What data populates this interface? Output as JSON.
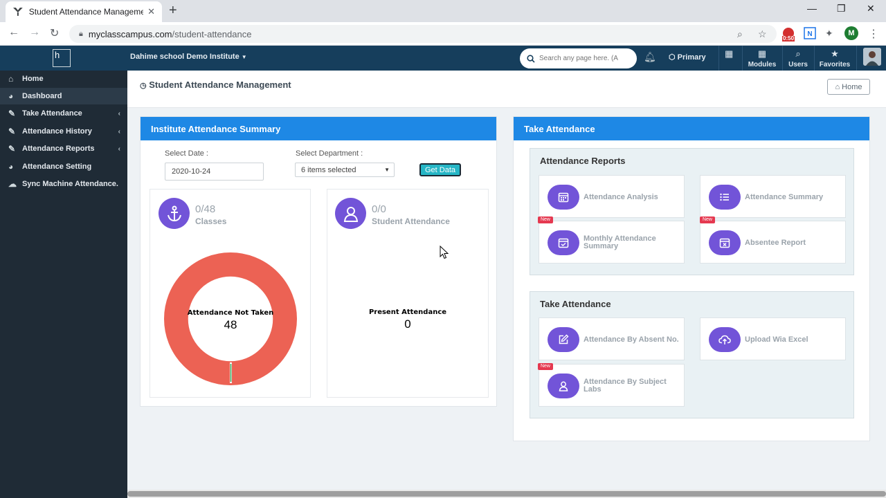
{
  "browser": {
    "tab_title": "Student Attendance Management",
    "url_host": "myclasscampus.com",
    "url_path": "/student-attendance",
    "timer": "0:50",
    "profile_initial": "M"
  },
  "header": {
    "institute": "Dahime school Demo Institute",
    "search_placeholder": "Search any page here. (A",
    "notif_count": "0",
    "primary": "Primary",
    "modules": "Modules",
    "users": "Users",
    "favorites": "Favorites"
  },
  "sidebar": {
    "items": [
      {
        "label": "Home"
      },
      {
        "label": "Dashboard"
      },
      {
        "label": "Take Attendance"
      },
      {
        "label": "Attendance History"
      },
      {
        "label": "Attendance Reports"
      },
      {
        "label": "Attendance Setting"
      },
      {
        "label": "Sync Machine Attendance."
      }
    ]
  },
  "page": {
    "title": "Student Attendance Management",
    "home_button": "Home"
  },
  "summary": {
    "title": "Institute Attendance Summary",
    "date_label": "Select Date :",
    "date_value": "2020-10-24",
    "dept_label": "Select Department :",
    "dept_value": "6 items selected",
    "get_data": "Get Data",
    "classes_count": "0/48",
    "classes_label": "Classes",
    "students_count": "0/0",
    "students_label": "Student Attendance",
    "donut_label": "Attendance Not Taken",
    "donut_value": "48",
    "present_label": "Present Attendance",
    "present_value": "0"
  },
  "take": {
    "title": "Take Attendance",
    "reports_title": "Attendance Reports",
    "reports": [
      {
        "label": "Attendance Analysis"
      },
      {
        "label": "Attendance Summary"
      },
      {
        "label": "Monthly Attendance Summary",
        "badge": "New"
      },
      {
        "label": "Absentee Report",
        "badge": "New"
      }
    ],
    "take_title": "Take Attendance",
    "actions": [
      {
        "label": "Attendance By Absent No."
      },
      {
        "label": "Upload Wia Excel"
      },
      {
        "label": "Attendance By Subject Labs",
        "badge": "New"
      }
    ]
  },
  "colors": {
    "accent_blue": "#1e88e5",
    "nav_dark": "#163e5c",
    "sidebar": "#1f2b36",
    "icon_purple": "#7254d8",
    "donut_red": "#ec6254"
  }
}
